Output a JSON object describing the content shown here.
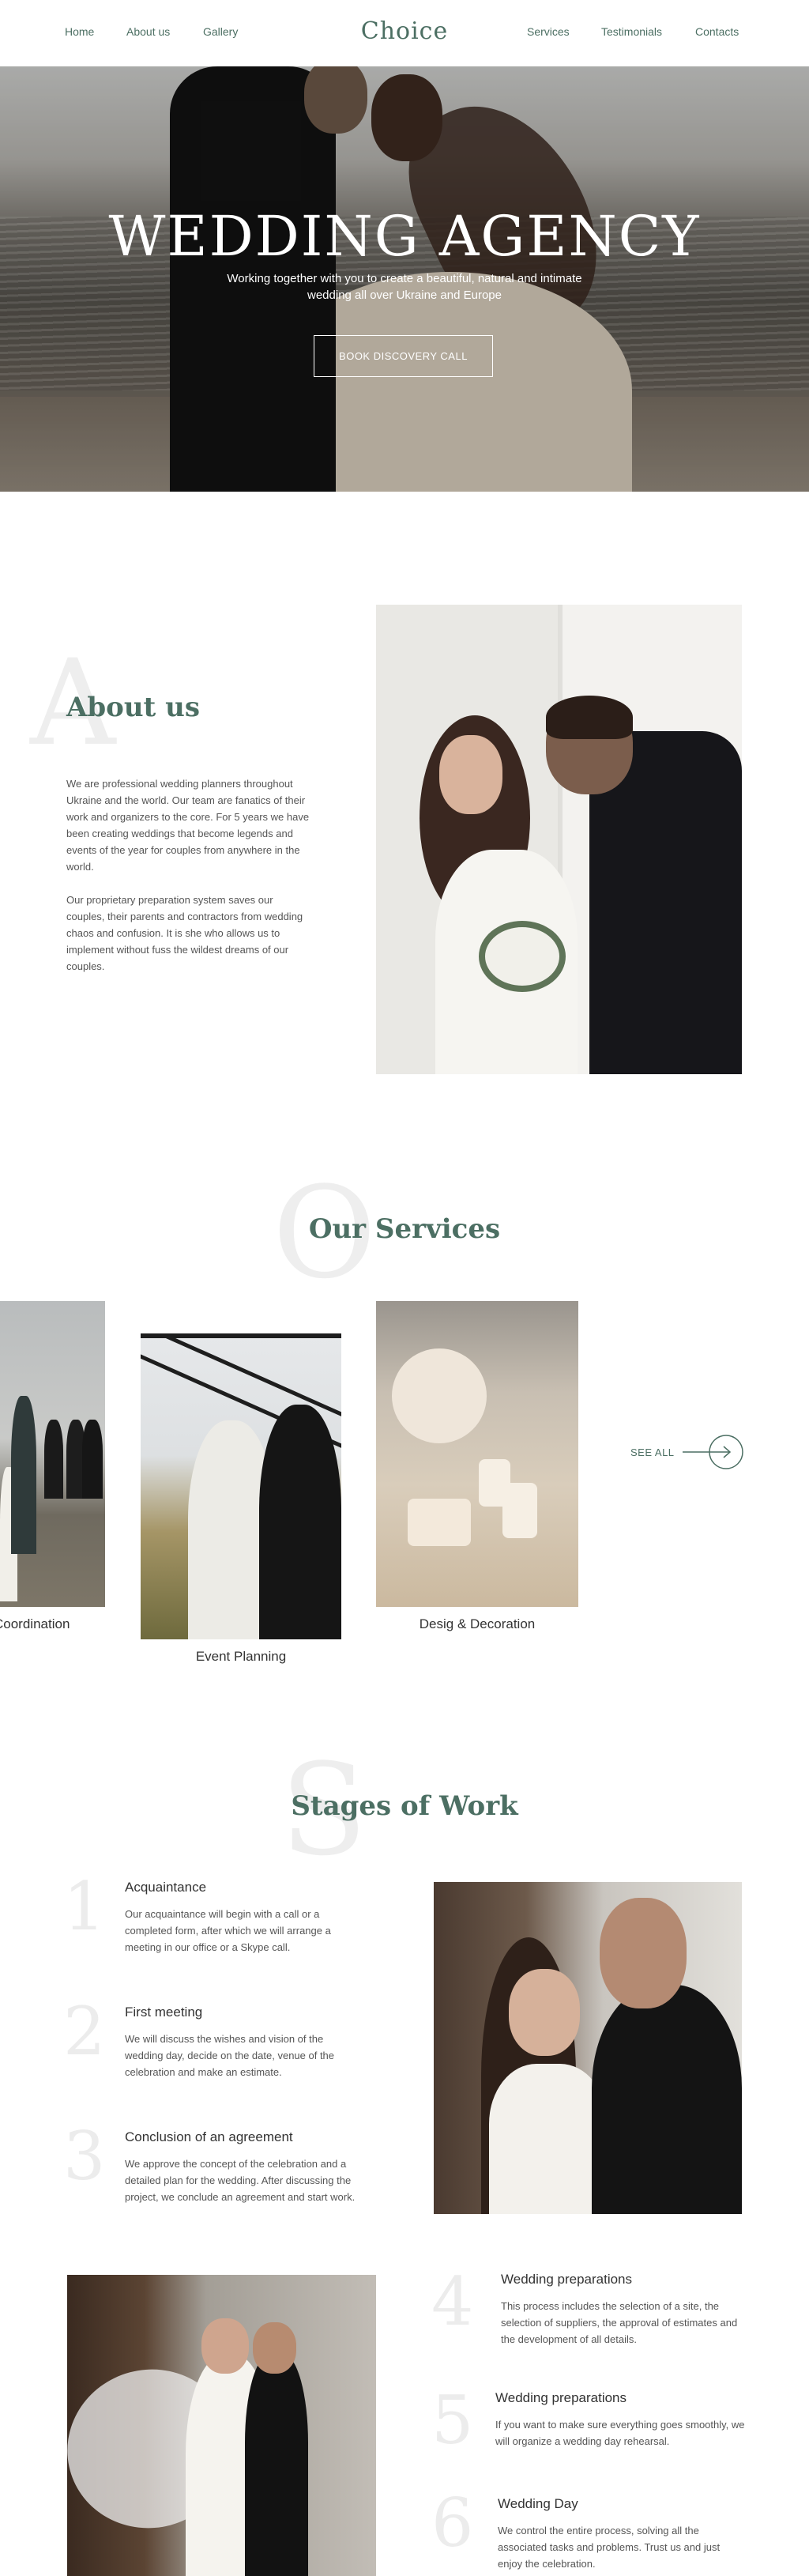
{
  "nav": {
    "logo": "Choice",
    "left_links": [
      "Home",
      "About us",
      "Gallery"
    ],
    "right_links": [
      "Services",
      "Testimonials",
      "Contacts"
    ]
  },
  "hero": {
    "title": "WEDDING AGENCY",
    "subtitle": "Working together with you to create a beautiful, natural and intimate wedding all over Ukraine and Europe",
    "button": "BOOK DISCOVERY CALL"
  },
  "about": {
    "letter": "A",
    "title": "About us",
    "paragraph1": "We are professional wedding planners throughout Ukraine and the world. Our team are fanatics of their work and organizers to the core. For 5 years we have been creating weddings that become legends and events of the year for couples from anywhere in the world.",
    "paragraph2": "Our proprietary preparation system saves our couples, their parents and contractors from wedding chaos and confusion. It is she who allows us to implement without fuss the wildest dreams of our couples."
  },
  "services": {
    "letter": "O",
    "title": "Our Services",
    "items": [
      {
        "label": "Coordination"
      },
      {
        "label": "Event Planning"
      },
      {
        "label": "Desig & Decoration"
      }
    ],
    "see_all": "SEE ALL"
  },
  "stages": {
    "letter": "S",
    "title": "Stages of Work",
    "items": [
      {
        "num": "1",
        "title": "Acquaintance",
        "text": "Our acquaintance will begin with a call or a completed form, after which we will arrange a meeting in our office or a Skype call."
      },
      {
        "num": "2",
        "title": "First meeting",
        "text": "We will discuss the wishes and vision of the wedding day, decide on the date, venue of the celebration and make an estimate."
      },
      {
        "num": "3",
        "title": "Conclusion of an agreement",
        "text": "We approve the concept of the celebration and a detailed plan for the wedding. After discussing the project, we conclude an agreement and start work."
      },
      {
        "num": "4",
        "title": "Wedding preparations",
        "text": "This process includes the selection of a site, the selection of suppliers, the approval of estimates and the development of all details."
      },
      {
        "num": "5",
        "title": "Wedding preparations",
        "text": "If you want to make sure everything goes smoothly, we will organize a wedding day rehearsal."
      },
      {
        "num": "6",
        "title": "Wedding Day",
        "text": "We control the entire process, solving all the associated tasks and problems. Trust us and just enjoy the celebration."
      }
    ]
  }
}
